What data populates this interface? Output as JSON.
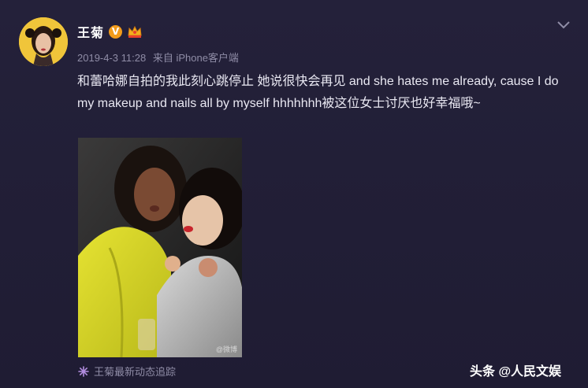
{
  "post": {
    "user_name": "王菊",
    "verified_badge": "V",
    "badge_icon": "crown-vip-icon",
    "date": "2019-4-3 11:28",
    "source": "来自 iPhone客户端",
    "text": "和蕾哈娜自拍的我此刻心跳停止 她说很快会再见 and she hates me already, cause I do my makeup and nails all by myself hhhhhhh被这位女士讨厌也好幸福哦~",
    "photo_watermark": "@微博"
  },
  "footer": {
    "tracking_link": "王菊最新动态追踪",
    "brand_watermark": "头条 @人民文娱"
  },
  "colors": {
    "background": "#221f37",
    "text": "#e9e8f2",
    "muted": "#8f8ca6",
    "avatar_bg": "#f0c53a",
    "badge": "#f29b1b"
  }
}
